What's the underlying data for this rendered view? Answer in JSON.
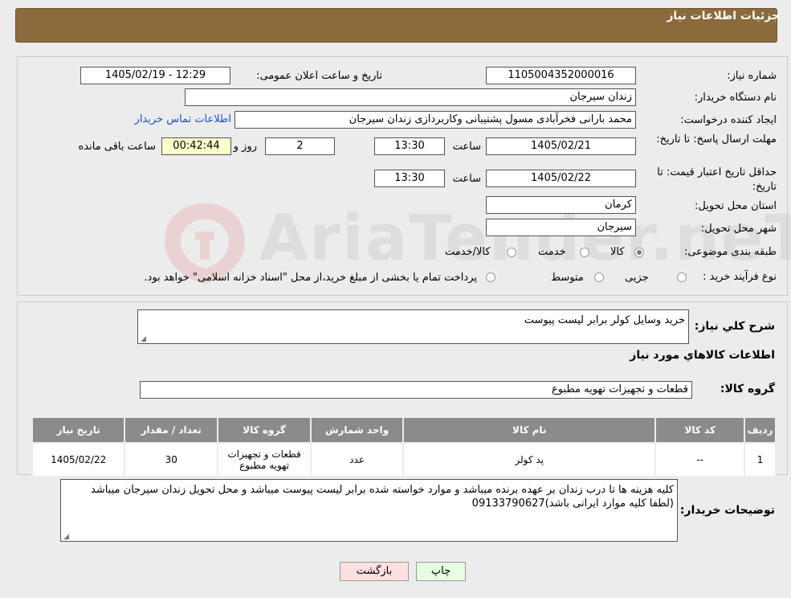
{
  "header": {
    "title": "جزئیات اطلاعات نیاز"
  },
  "form": {
    "need_number_label": "شماره نیاز:",
    "need_number": "1105004352000016",
    "announce_label": "تاریخ و ساعت اعلان عمومی:",
    "announce_value": "1405/02/19 - 12:29",
    "buyer_org_label": "نام دستگاه خریدار:",
    "buyer_org": "زندان سیرجان",
    "creator_label": "ایجاد کننده درخواست:",
    "creator": "محمد بارانی فخرآبادی مسول پشتیبانی وکاربردازی زندان سیرجان",
    "contact_link": "اطلاعات تماس خریدار",
    "deadline_label": "مهلت ارسال پاسخ: تا تاریخ:",
    "deadline_date": "1405/02/21",
    "time_label": "ساعت",
    "deadline_time": "13:30",
    "days_value": "2",
    "days_label": "روز و",
    "remaining_time": "00:42:44",
    "remaining_label": "ساعت باقی مانده",
    "validity_label": "حداقل تاریخ اعتبار قیمت: تا تاریخ:",
    "validity_date": "1405/02/22",
    "validity_time_label": "ساعت",
    "validity_time": "13:30",
    "province_label": "استان محل تحویل:",
    "province": "کرمان",
    "city_label": "شهر محل تحویل:",
    "city": "سیرجان",
    "category_label": "طبقه بندی موضوعی:",
    "category_options": [
      "کالا",
      "خدمت",
      "کالا/خدمت"
    ],
    "process_label": "نوع فرآیند خرید :",
    "process_options": [
      "جزیی",
      "متوسط"
    ],
    "process_note": "پرداخت تمام یا بخشی از مبلغ خرید،از محل \"اسناد خزانه اسلامی\" خواهد بود."
  },
  "details": {
    "summary_label": "شرح كلي نياز:",
    "summary": "خرید وسایل کولر برابر لیست پیوست",
    "goods_info_title": "اطلاعات كالاهاي مورد نياز",
    "goods_group_label": "گروه کالا:",
    "goods_group": "قطعات و تجهیزات تهویه مطبوع",
    "table": {
      "headers": [
        "رديف",
        "كد كالا",
        "نام كالا",
        "واحد شمارش",
        "گروه كالا",
        "تعداد / مقدار",
        "تاريخ نياز"
      ],
      "rows": [
        [
          "1",
          "--",
          "پد کولر",
          "عدد",
          "قطعات و تجهیزات تهویه مطبوع",
          "30",
          "1405/02/22"
        ]
      ]
    },
    "buyer_notes_label": "توضیحات خریدار:",
    "buyer_notes": "کلیه هزینه ها تا درب زندان بر عهده برنده میباشد و موارد خواسته شده برابر لیست پیوست میباشد   و محل تحویل زندان سیرجان میباشد (لطفا کلیه موارد ایرانی باشد)09133790627"
  },
  "buttons": {
    "print": "چاپ",
    "back": "بازگشت"
  },
  "watermark": {
    "text": "AriaTender.neT"
  },
  "colors": {
    "header": "#8b6a3c",
    "link": "#1a4fd6",
    "table_header": "#8b8b8b",
    "back_button": "#fde0e0",
    "print_button": "#e6ffe0"
  }
}
